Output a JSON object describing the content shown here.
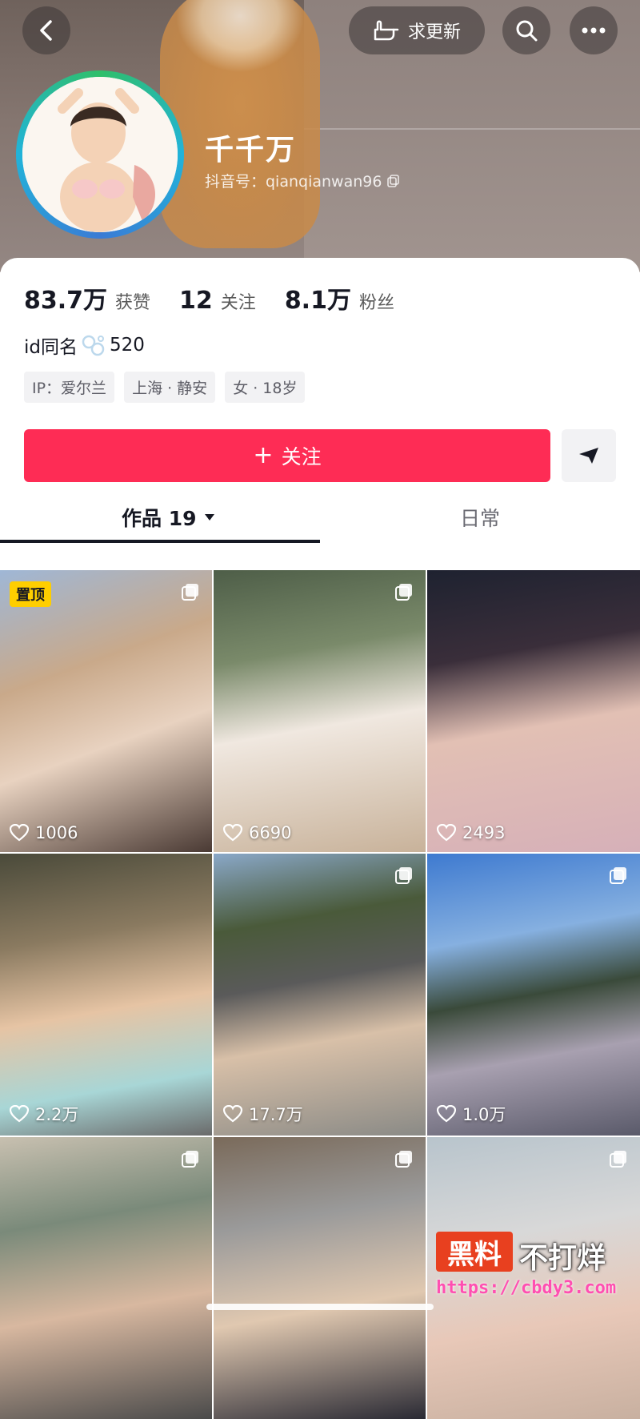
{
  "header": {
    "update_label": "求更新",
    "nickname": "千千万",
    "douyin_id": "抖音号：qianqianwan96"
  },
  "stats": [
    {
      "value": "83.7万",
      "label": "获赞"
    },
    {
      "value": "12",
      "label": "关注"
    },
    {
      "value": "8.1万",
      "label": "粉丝"
    }
  ],
  "bio": {
    "prefix": "id同名",
    "suffix": "520"
  },
  "tags": [
    "IP：爱尔兰",
    "上海 · 静安",
    "女 · 18岁"
  ],
  "actions": {
    "follow_label": "关注",
    "follow_plus": "+"
  },
  "tabs": {
    "works": "作品 19",
    "daily": "日常"
  },
  "grid": [
    {
      "likes": "1006",
      "pinned": "置顶"
    },
    {
      "likes": "6690"
    },
    {
      "likes": "2493"
    },
    {
      "likes": "2.2万"
    },
    {
      "likes": "17.7万"
    },
    {
      "likes": "1.0万"
    },
    {
      "likes": ""
    },
    {
      "likes": ""
    },
    {
      "likes": ""
    }
  ],
  "watermark": {
    "badge": "黑料",
    "text": "不打烊",
    "url": "https://cbdy3.com"
  }
}
